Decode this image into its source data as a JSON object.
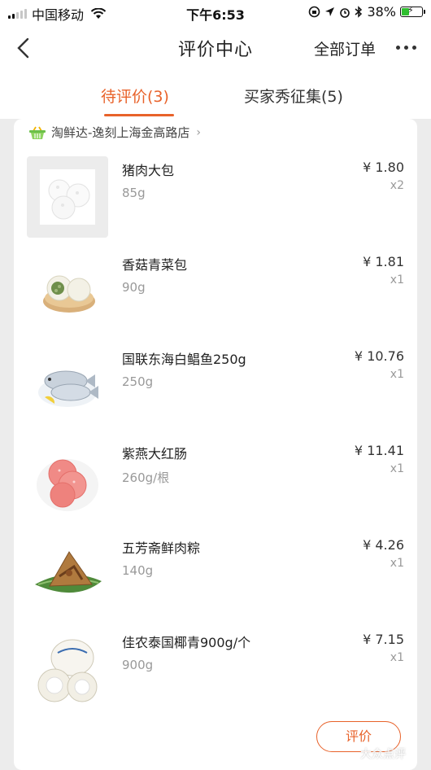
{
  "status_bar": {
    "carrier": "中国移动",
    "time": "下午6:53",
    "battery_percent": "38%",
    "battery_level": 0.38
  },
  "nav": {
    "title": "评价中心",
    "all_orders": "全部订单"
  },
  "tabs": [
    {
      "label": "待评价(3)",
      "active": true
    },
    {
      "label": "买家秀征集(5)",
      "active": false
    }
  ],
  "store": {
    "name": "淘鲜达-逸刻上海金高路店",
    "chevron": "›"
  },
  "items": [
    {
      "name": "猪肉大包",
      "weight": "85g",
      "price": "¥ 1.80",
      "qty": "x2",
      "image": "steamed-buns-image"
    },
    {
      "name": "香菇青菜包",
      "weight": "90g",
      "price": "¥ 1.81",
      "qty": "x1",
      "image": "vegetable-buns-image"
    },
    {
      "name": "国联东海白鲳鱼250g",
      "weight": "250g",
      "price": "¥ 10.76",
      "qty": "x1",
      "image": "pomfret-fish-image"
    },
    {
      "name": "紫燕大红肠",
      "weight": "260g/根",
      "price": "¥ 11.41",
      "qty": "x1",
      "image": "red-sausage-image"
    },
    {
      "name": "五芳斋鲜肉粽",
      "weight": "140g",
      "price": "¥ 4.26",
      "qty": "x1",
      "image": "zongzi-image"
    },
    {
      "name": "佳农泰国椰青900g/个",
      "weight": "900g",
      "price": "¥ 7.15",
      "qty": "x1",
      "image": "coconut-image"
    }
  ],
  "review_button": "评价",
  "watermark": "大众点评",
  "colors": {
    "accent": "#e8622a",
    "background": "#ececec"
  }
}
